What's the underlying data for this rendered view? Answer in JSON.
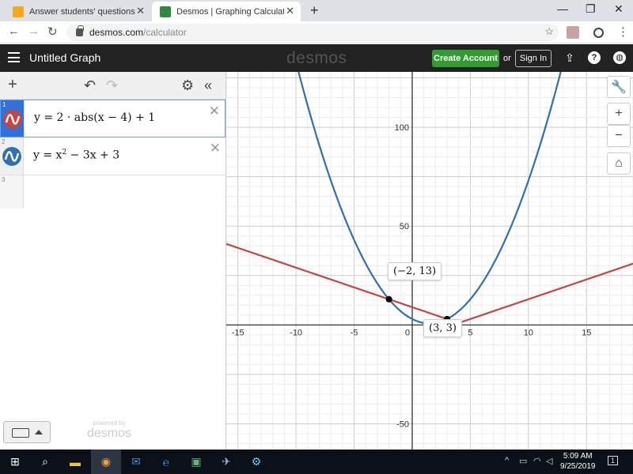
{
  "browser": {
    "tabs": [
      {
        "label": "Answer students' questions and"
      },
      {
        "label": "Desmos | Graphing Calculator"
      }
    ],
    "new_tab": "+",
    "url_host": "desmos.com",
    "url_path": "/calculator"
  },
  "app": {
    "graph_title": "Untitled Graph",
    "logo": "desmos",
    "create_account": "Create Account",
    "or": "or",
    "sign_in": "Sign In"
  },
  "expressions": [
    {
      "index": "1",
      "formula_html": "y = 2 · abs(x − 4) + 1",
      "color": "#c74440"
    },
    {
      "index": "2",
      "formula_pre": "y = x",
      "formula_sup": "2",
      "formula_post": " − 3x + 3",
      "color": "#2d70b3"
    },
    {
      "index": "3"
    }
  ],
  "powered_by": {
    "line1": "powered by",
    "line2": "desmos"
  },
  "graph": {
    "x_ticks": [
      "-15",
      "-10",
      "-5",
      "0",
      "5",
      "10",
      "15"
    ],
    "y_ticks": [
      "100",
      "50",
      "-50"
    ],
    "points": [
      {
        "label": "(−2, 13)"
      },
      {
        "label": "(3, 3)"
      }
    ]
  },
  "chart_data": {
    "type": "line",
    "xlim": [
      -16,
      19
    ],
    "ylim": [
      -63,
      128
    ],
    "series": [
      {
        "formula": "y = 2 · abs(x − 4) + 1",
        "color": "#c74440"
      },
      {
        "formula": "y = x^2 − 3x + 3",
        "color": "#2d70b3"
      }
    ],
    "intersections": [
      [
        -2,
        13
      ],
      [
        3,
        3
      ]
    ],
    "x_ticks": [
      -15,
      -10,
      -5,
      0,
      5,
      10,
      15
    ],
    "y_ticks": [
      100,
      50,
      -50
    ],
    "grid": true
  },
  "taskbar": {
    "time": "5:09 AM",
    "date": "9/25/2019",
    "notification_count": "1"
  }
}
